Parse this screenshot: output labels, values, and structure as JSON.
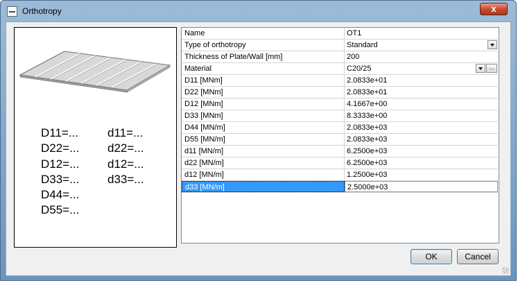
{
  "window": {
    "title": "Orthotropy",
    "close_label": "x"
  },
  "preview": {
    "labels_left": [
      "D11=...",
      "D22=...",
      "D12=...",
      "D33=...",
      "D44=...",
      "D55=..."
    ],
    "labels_right": [
      "d11=...",
      "d22=...",
      "d12=...",
      "d33=..."
    ]
  },
  "properties": [
    {
      "name": "Name",
      "value": "OT1"
    },
    {
      "name": "Type of orthotropy",
      "value": "Standard"
    },
    {
      "name": "Thickness of Plate/Wall [mm]",
      "value": "200"
    },
    {
      "name": "Material",
      "value": "C20/25"
    },
    {
      "name": "D11 [MNm]",
      "value": "2.0833e+01"
    },
    {
      "name": "D22 [MNm]",
      "value": "2.0833e+01"
    },
    {
      "name": "D12 [MNm]",
      "value": "4.1667e+00"
    },
    {
      "name": "D33 [MNm]",
      "value": "8.3333e+00"
    },
    {
      "name": "D44 [MN/m]",
      "value": "2.0833e+03"
    },
    {
      "name": "D55 [MN/m]",
      "value": "2.0833e+03"
    },
    {
      "name": "d11 [MN/m]",
      "value": "6.2500e+03"
    },
    {
      "name": "d22 [MN/m]",
      "value": "6.2500e+03"
    },
    {
      "name": "d12 [MN/m]",
      "value": "1.2500e+03"
    },
    {
      "name": "d33 [MN/m]",
      "value": "2.5000e+03"
    }
  ],
  "material_more_label": "...",
  "buttons": {
    "ok": "OK",
    "cancel": "Cancel"
  },
  "background": {
    "fragment": "D44="
  },
  "colors": {
    "selection": "#3399ff",
    "titlebar": "#9cbbd8",
    "close": "#c4482b"
  }
}
